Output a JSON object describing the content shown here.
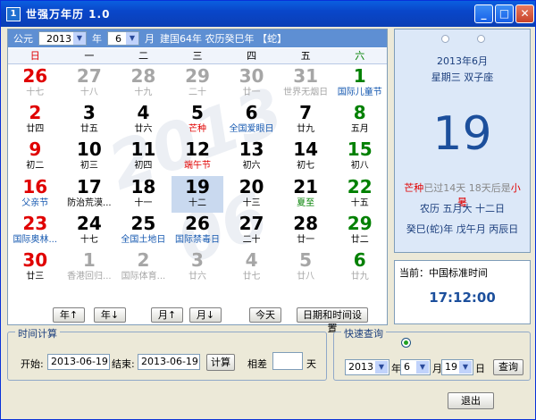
{
  "window": {
    "title": "世强万年历 1.0",
    "icon": "calendar-app-icon",
    "min": "_",
    "max": "□",
    "close": "✕"
  },
  "header": {
    "gregorian_label": "公元",
    "year_value": "2013",
    "year_label": "年",
    "month_value": "6",
    "month_label": "月",
    "info": "建国64年 农历癸巳年 【蛇】"
  },
  "weekdays": [
    "日",
    "一",
    "二",
    "三",
    "四",
    "五",
    "六"
  ],
  "watermark": {
    "year": "2013",
    "month": "06"
  },
  "days": [
    {
      "n": "26",
      "s": "十七",
      "other": true
    },
    {
      "n": "27",
      "s": "十八",
      "other": true
    },
    {
      "n": "28",
      "s": "十九",
      "other": true
    },
    {
      "n": "29",
      "s": "二十",
      "other": true
    },
    {
      "n": "30",
      "s": "廿一",
      "other": true
    },
    {
      "n": "31",
      "s": "世界无烟日",
      "other": true
    },
    {
      "n": "1",
      "s": "国际儿童节",
      "fest": true
    },
    {
      "n": "2",
      "s": "廿四"
    },
    {
      "n": "3",
      "s": "廿五"
    },
    {
      "n": "4",
      "s": "廿六"
    },
    {
      "n": "5",
      "s": "芒种",
      "term": true
    },
    {
      "n": "6",
      "s": "全国爱眼日",
      "fest": true
    },
    {
      "n": "7",
      "s": "廿九"
    },
    {
      "n": "8",
      "s": "五月"
    },
    {
      "n": "9",
      "s": "初二"
    },
    {
      "n": "10",
      "s": "初三"
    },
    {
      "n": "11",
      "s": "初四"
    },
    {
      "n": "12",
      "s": "端午节",
      "term": true
    },
    {
      "n": "13",
      "s": "初六"
    },
    {
      "n": "14",
      "s": "初七"
    },
    {
      "n": "15",
      "s": "初八"
    },
    {
      "n": "16",
      "s": "父亲节",
      "fest": true
    },
    {
      "n": "17",
      "s": "防治荒漠..."
    },
    {
      "n": "18",
      "s": "十一"
    },
    {
      "n": "19",
      "s": "十二",
      "today": true
    },
    {
      "n": "20",
      "s": "十三"
    },
    {
      "n": "21",
      "s": "夏至",
      "termg": true
    },
    {
      "n": "22",
      "s": "十五"
    },
    {
      "n": "23",
      "s": "国际奥林...",
      "fest": true
    },
    {
      "n": "24",
      "s": "十七"
    },
    {
      "n": "25",
      "s": "全国土地日",
      "fest": true
    },
    {
      "n": "26",
      "s": "国际禁毒日",
      "fest": true
    },
    {
      "n": "27",
      "s": "二十"
    },
    {
      "n": "28",
      "s": "廿一"
    },
    {
      "n": "29",
      "s": "廿二"
    },
    {
      "n": "30",
      "s": "廿三"
    },
    {
      "n": "1",
      "s": "香港回归...",
      "other": true
    },
    {
      "n": "2",
      "s": "国际体育...",
      "other": true
    },
    {
      "n": "3",
      "s": "廿六",
      "other": true
    },
    {
      "n": "4",
      "s": "廿七",
      "other": true
    },
    {
      "n": "5",
      "s": "廿八",
      "other": true
    },
    {
      "n": "6",
      "s": "廿九",
      "other": true
    }
  ],
  "nav": {
    "year_up": "年↑",
    "year_down": "年↓",
    "month_up": "月↑",
    "month_down": "月↓",
    "today": "今天",
    "datetime_settings": "日期和时间设置"
  },
  "right_panel": {
    "year_month": "2013年6月",
    "weekday_sign": "星期三  双子座",
    "big_day": "19",
    "term_prev": "芒种",
    "term_prev_text": "已过14天",
    "term_next_text": "18天后是",
    "term_next": "小暑",
    "lunar_line": "农历   五月大  十二日",
    "ganzhi_line": "癸巳(蛇)年  戊午月  丙辰日"
  },
  "time_panel": {
    "tz_label": "当前：中国标准时间",
    "clock": "17:12:00"
  },
  "calc": {
    "group_label": "时间计算",
    "start_label": "开始:",
    "start_value": "2013-06-19",
    "end_label": "结束:",
    "end_value": "2013-06-19",
    "calc_button": "计算",
    "diff_label": "相差",
    "diff_value": "",
    "diff_unit": "天"
  },
  "quick": {
    "group_label": "快速查询",
    "year_value": "2013",
    "year_label": "年",
    "month_value": "6",
    "month_label": "月",
    "day_value": "19",
    "day_label": "日",
    "query_button": "查询"
  },
  "exit_button": "退出"
}
